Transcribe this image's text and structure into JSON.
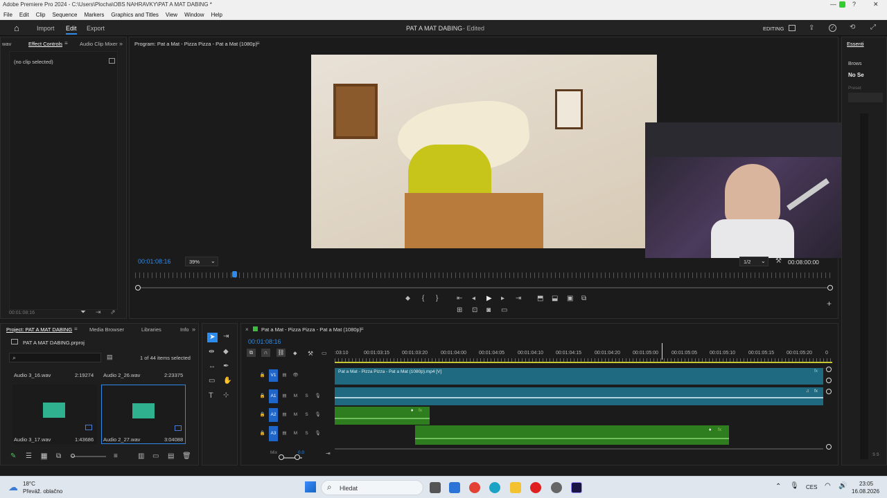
{
  "window": {
    "title": "Adobe Premiere Pro 2024 - C:\\Users\\Plocha\\OBS NAHRAVKY\\PAT A MAT DABING *",
    "min": "—",
    "help": "?",
    "close": "✕"
  },
  "menu": [
    "File",
    "Edit",
    "Clip",
    "Sequence",
    "Markers",
    "Graphics and Titles",
    "View",
    "Window",
    "Help"
  ],
  "appbar": {
    "home": "⌂",
    "import": "Import",
    "edit": "Edit",
    "export": "Export",
    "project_title": "PAT A MAT DABING",
    "edited": "- Edited",
    "workspace": "EDITING"
  },
  "effect_panel": {
    "tab_left": "wav",
    "tab_effect": "Effect Controls",
    "tab_mixer": "Audio Clip Mixer",
    "more": "»",
    "no_clip": "(no clip selected)",
    "timecode": "00:01:08:16"
  },
  "program": {
    "title": "Program: Pat a Mat - Pizza Pizza - Pat a Mat (1080p)",
    "timecode": "00:01:08:16",
    "zoom": "39%",
    "res": "1/2",
    "duration": "00:08:00:00"
  },
  "right_panel": {
    "tab": "Essenti",
    "browse": "Brows",
    "no_sel": "No Se",
    "preset": "Preset"
  },
  "project": {
    "tab": "Project: PAT A MAT DABING",
    "media": "Media Browser",
    "libraries": "Libraries",
    "info": "Info",
    "file": "PAT A MAT DABING.prproj",
    "selected": "1 of 44 items selected",
    "items": [
      {
        "name": "Audio 3_16.wav",
        "dur": "2:19274"
      },
      {
        "name": "Audio 2_26.wav",
        "dur": "2:23375"
      },
      {
        "name": "Audio 3_17.wav",
        "dur": "1:43686"
      },
      {
        "name": "Audio 2_27.wav",
        "dur": "3:04088"
      }
    ]
  },
  "timeline": {
    "tab": "Pat a Mat - Pizza Pizza - Pat a Mat (1080p)",
    "timecode": "00:01:08:16",
    "ruler": [
      ":03:10",
      "00:01:03:15",
      "00:01:03:20",
      "00:01:04:00",
      "00:01:04:05",
      "00:01:04:10",
      "00:01:04:15",
      "00:01:04:20",
      "00:01:05:00",
      "00:01:05:05",
      "00:01:05:10",
      "00:01:05:15",
      "00:01:05:20",
      "0"
    ],
    "tracks": [
      {
        "id": "V1"
      },
      {
        "id": "A1"
      },
      {
        "id": "A2"
      },
      {
        "id": "A3"
      }
    ],
    "mix": "Mix",
    "mix_val": "0.0",
    "m": "M",
    "s": "S",
    "v1_clip": "Pat a Mat - Pizza Pizza - Pat a Mat (1080p).mp4 [V]",
    "fx": "fx"
  },
  "taskbar": {
    "temp": "18°C",
    "weather": "Převáž. oblačno",
    "search": "Hledat",
    "lang": "CES",
    "time": "23:05",
    "date": "16.08.2026"
  },
  "colors": {
    "accent": "#2d8ceb",
    "audio_clip": "#2e7d1f",
    "video_clip": "#1f6a80",
    "blue_label": "#1f66c8"
  }
}
